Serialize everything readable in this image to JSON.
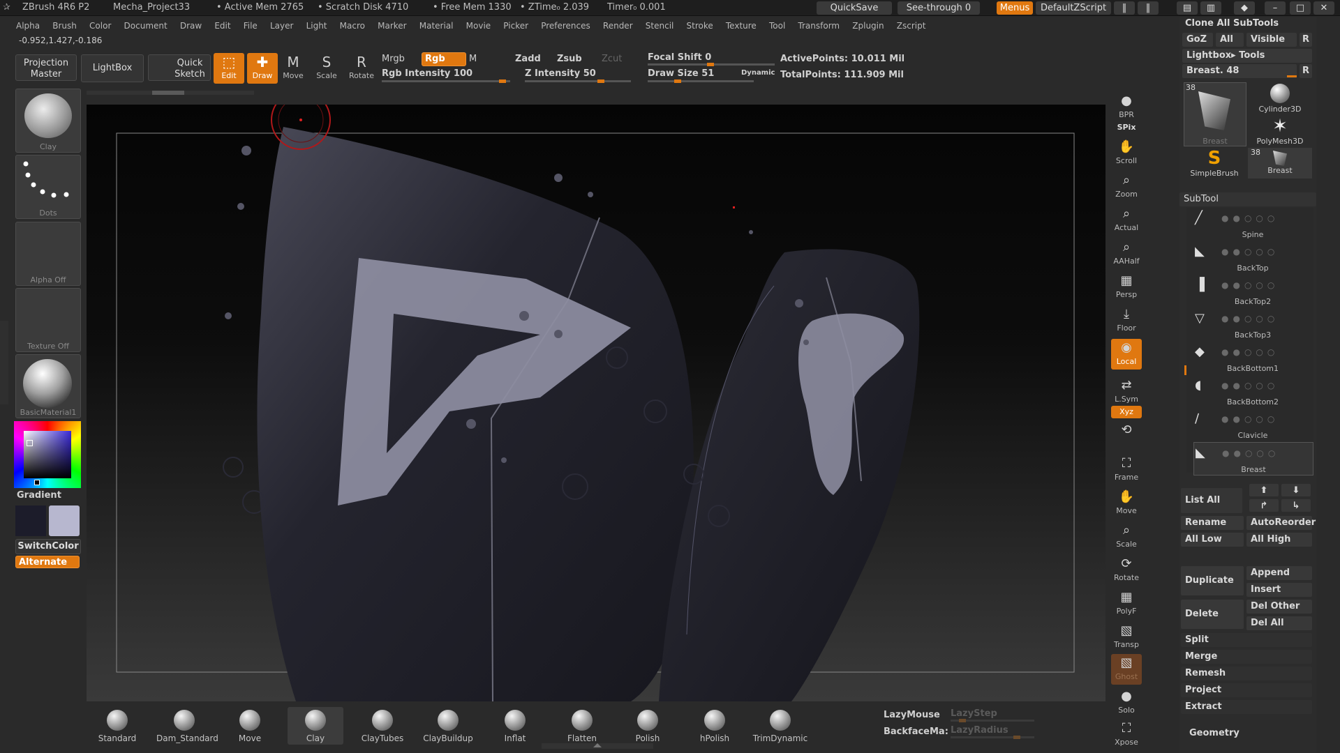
{
  "titlebar": {
    "app": "ZBrush 4R6 P2",
    "project": "Mecha_Project33",
    "active_mem": "• Active Mem 2765",
    "scratch_disk": "• Scratch Disk 4710",
    "free_mem": "• Free Mem 1330",
    "ztime": "• ZTime₀ 2.039",
    "timer": "Timer₀ 0.001",
    "quicksave": "QuickSave",
    "see_through": "See-through  0",
    "menus": "Menus",
    "default_zscript": "DefaultZScript"
  },
  "menu": [
    "Alpha",
    "Brush",
    "Color",
    "Document",
    "Draw",
    "Edit",
    "File",
    "Layer",
    "Light",
    "Macro",
    "Marker",
    "Material",
    "Movie",
    "Picker",
    "Preferences",
    "Render",
    "Stencil",
    "Stroke",
    "Texture",
    "Tool",
    "Transform",
    "Zplugin",
    "Zscript"
  ],
  "coords": "-0.952,1.427,-0.186",
  "shelf": {
    "projection_master": "Projection Master",
    "lightbox": "LightBox",
    "quick_sketch": "Quick Sketch",
    "edit": "Edit",
    "draw": "Draw",
    "move": "Move",
    "scale": "Scale",
    "rotate": "Rotate",
    "mrgb": "Mrgb",
    "rgb": "Rgb",
    "m": "M",
    "rgb_intensity": "Rgb  Intensity 100",
    "zadd": "Zadd",
    "zsub": "Zsub",
    "zcut": "Zcut",
    "z_intensity": "Z  Intensity 50",
    "focal_shift": "Focal  Shift 0",
    "draw_size": "Draw  Size 51",
    "dynamic": "Dynamic",
    "active_points": "ActivePoints: 10.011  Mil",
    "total_points": "TotalPoints: 111.909  Mil"
  },
  "left": {
    "brush": "Clay",
    "stroke": "Dots",
    "alpha": "Alpha  Off",
    "texture": "Texture  Off",
    "material": "BasicMaterial1",
    "gradient": "Gradient",
    "switchcolor": "SwitchColor",
    "alternate": "Alternate"
  },
  "right_tools": [
    "BPR",
    "SPix",
    "Scroll",
    "Zoom",
    "Actual",
    "AAHalf",
    "Persp",
    "Floor",
    "Local",
    "L.Sym",
    "Xyz",
    "Frame",
    "Move",
    "Scale",
    "Rotate",
    "PolyF",
    "Transp",
    "Ghost",
    "Solo",
    "Xpose"
  ],
  "panel": {
    "clone_all": "Clone  All  SubTools",
    "goz": "GoZ",
    "all": "All",
    "visible": "Visible",
    "r": "R",
    "lightbox_tools": "Lightbox▸ Tools",
    "breast_slider": "Breast. 48",
    "tool_breast": "Breast",
    "tool_cyl": "Cylinder3D",
    "tool_poly": "PolyMesh3D",
    "tool_simple": "SimpleBrush",
    "tool_breast2": "Breast",
    "tool_count": "38",
    "subtool_header": "SubTool",
    "subtools": [
      "Spine",
      "BackTop",
      "BackTop2",
      "BackTop3",
      "BackBottom1",
      "BackBottom2",
      "Clavicle",
      "Breast"
    ],
    "list_all": "List  All",
    "rename": "Rename",
    "autoreorder": "AutoReorder",
    "all_low": "All  Low",
    "all_high": "All  High",
    "duplicate": "Duplicate",
    "append": "Append",
    "insert": "Insert",
    "delete": "Delete",
    "del_other": "Del  Other",
    "del_all": "Del  All",
    "split": "Split",
    "merge": "Merge",
    "remesh": "Remesh",
    "project": "Project",
    "extract": "Extract",
    "geometry": "Geometry"
  },
  "bottom_brushes": [
    "Standard",
    "Dam_Standard",
    "Move",
    "Clay",
    "ClayTubes",
    "ClayBuildup",
    "Inflat",
    "Flatten",
    "Polish",
    "hPolish",
    "TrimDynamic"
  ],
  "bottom": {
    "lazymouse": "LazyMouse",
    "lazystep": "LazyStep",
    "backfacemask": "BackfaceMa:",
    "lazyradius": "LazyRadius"
  },
  "colors": {
    "accent": "#e07810",
    "panel": "#2c2c2c",
    "bg": "#2a2a2a"
  }
}
